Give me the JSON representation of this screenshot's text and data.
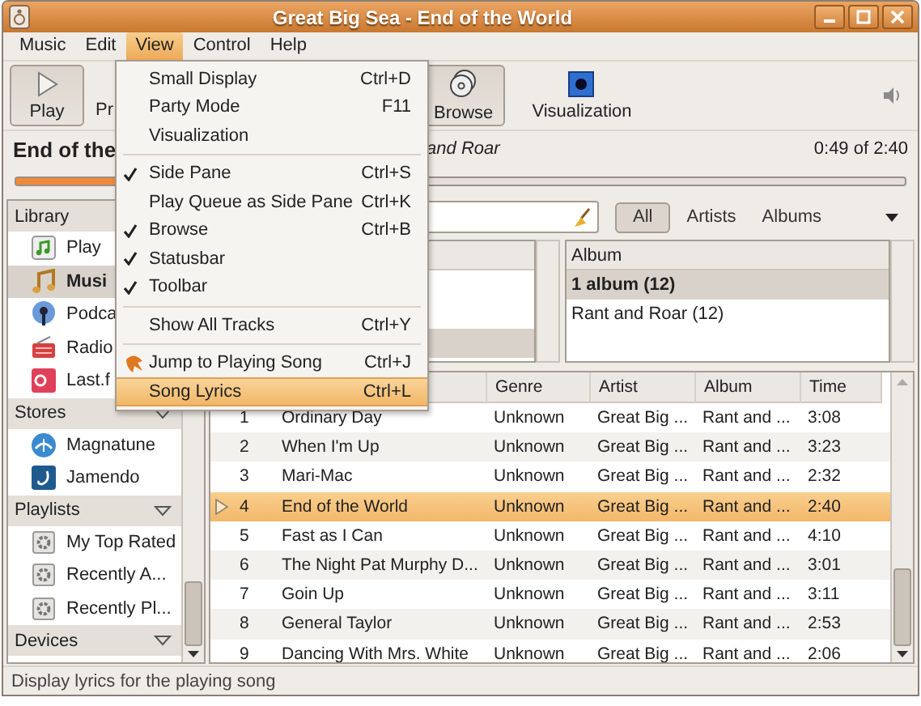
{
  "window": {
    "title": "Great Big Sea - End of the World"
  },
  "menubar": [
    {
      "label": "Music",
      "selected": false
    },
    {
      "label": "Edit",
      "selected": false
    },
    {
      "label": "View",
      "selected": true
    },
    {
      "label": "Control",
      "selected": false
    },
    {
      "label": "Help",
      "selected": false
    }
  ],
  "toolbar": [
    {
      "kind": "play",
      "label": "Play",
      "pressed": true
    },
    {
      "kind": "previous",
      "label": "Pr",
      "pressed": false
    },
    {
      "kind": "browse",
      "label": "Browse",
      "pressed": true
    },
    {
      "kind": "visualization",
      "label": "Visualization",
      "pressed": false
    }
  ],
  "now_playing": {
    "title": "End of the",
    "subtitle": "and Roar",
    "time": "0:49 of 2:40",
    "level": 0.31
  },
  "sidebar": [
    {
      "title": "Library",
      "items": [
        {
          "kind": "queue",
          "label": "Play",
          "selected": false
        },
        {
          "kind": "music",
          "label": "Musi",
          "selected": true
        },
        {
          "kind": "podcast",
          "label": "Podca",
          "selected": false
        },
        {
          "kind": "radio",
          "label": "Radio",
          "selected": false
        },
        {
          "kind": "lastfm",
          "label": "Last.f",
          "selected": false
        }
      ]
    },
    {
      "title": "Stores",
      "items": [
        {
          "kind": "magnatune",
          "label": "Magnatune",
          "selected": false
        },
        {
          "kind": "jamendo",
          "label": "Jamendo",
          "selected": false
        }
      ]
    },
    {
      "title": "Playlists",
      "items": [
        {
          "kind": "auto",
          "label": "My Top Rated",
          "selected": false
        },
        {
          "kind": "auto",
          "label": "Recently A...",
          "selected": false
        },
        {
          "kind": "auto",
          "label": "Recently Pl...",
          "selected": false
        }
      ]
    },
    {
      "title": "Devices"
    }
  ],
  "filter_tabs": [
    {
      "label": "All",
      "selected": true
    },
    {
      "label": "Artists",
      "selected": false
    },
    {
      "label": "Albums",
      "selected": false
    }
  ],
  "album_browser": {
    "header": "Album",
    "rows": [
      {
        "label": "1 album (12)",
        "selected": true
      },
      {
        "label": "Rant and Roar (12)",
        "selected": false
      }
    ]
  },
  "tracks": {
    "columns": [
      "Genre",
      "Artist",
      "Album",
      "Time"
    ],
    "rows": [
      {
        "number": "1",
        "title": "Ordinary Day",
        "genre": "Unknown",
        "artist": "Great Big ...",
        "album": "Rant and ...",
        "time": "3:08",
        "playing": false,
        "selected": false
      },
      {
        "number": "2",
        "title": "When I'm Up",
        "genre": "Unknown",
        "artist": "Great Big ...",
        "album": "Rant and ...",
        "time": "3:23",
        "playing": false,
        "selected": false
      },
      {
        "number": "3",
        "title": "Mari-Mac",
        "genre": "Unknown",
        "artist": "Great Big ...",
        "album": "Rant and ...",
        "time": "2:32",
        "playing": false,
        "selected": false
      },
      {
        "number": "4",
        "title": "End of the World",
        "genre": "Unknown",
        "artist": "Great Big ...",
        "album": "Rant and ...",
        "time": "2:40",
        "playing": true,
        "selected": true
      },
      {
        "number": "5",
        "title": "Fast as I Can",
        "genre": "Unknown",
        "artist": "Great Big ...",
        "album": "Rant and ...",
        "time": "4:10",
        "playing": false,
        "selected": false
      },
      {
        "number": "6",
        "title": "The Night Pat Murphy D...",
        "genre": "Unknown",
        "artist": "Great Big ...",
        "album": "Rant and ...",
        "time": "3:01",
        "playing": false,
        "selected": false
      },
      {
        "number": "7",
        "title": "Goin Up",
        "genre": "Unknown",
        "artist": "Great Big ...",
        "album": "Rant and ...",
        "time": "3:11",
        "playing": false,
        "selected": false
      },
      {
        "number": "8",
        "title": "General Taylor",
        "genre": "Unknown",
        "artist": "Great Big ...",
        "album": "Rant and ...",
        "time": "2:53",
        "playing": false,
        "selected": false
      },
      {
        "number": "9",
        "title": "Dancing With Mrs. White",
        "genre": "Unknown",
        "artist": "Great Big ...",
        "album": "Rant and ...",
        "time": "2:06",
        "playing": false,
        "selected": false
      }
    ]
  },
  "view_menu": [
    {
      "kind": "item",
      "label": "Small Display",
      "shortcut": "Ctrl+D",
      "selected": false
    },
    {
      "kind": "item",
      "label": "Party Mode",
      "shortcut": "F11",
      "selected": false
    },
    {
      "kind": "item",
      "label": "Visualization",
      "selected": false
    },
    {
      "kind": "separator"
    },
    {
      "kind": "check",
      "label": "Side Pane",
      "shortcut": "Ctrl+S",
      "checked": true,
      "selected": false
    },
    {
      "kind": "check",
      "label": "Play Queue as Side Pane",
      "shortcut": "Ctrl+K",
      "checked": false,
      "selected": false
    },
    {
      "kind": "check",
      "label": "Browse",
      "shortcut": "Ctrl+B",
      "checked": true,
      "selected": false
    },
    {
      "kind": "check",
      "label": "Statusbar",
      "checked": true,
      "selected": false
    },
    {
      "kind": "check",
      "label": "Toolbar",
      "checked": true,
      "selected": false
    },
    {
      "kind": "separator"
    },
    {
      "kind": "item",
      "label": "Show All Tracks",
      "shortcut": "Ctrl+Y",
      "selected": false
    },
    {
      "kind": "separator"
    },
    {
      "kind": "jump",
      "label": "Jump to Playing Song",
      "shortcut": "Ctrl+J",
      "selected": false
    },
    {
      "kind": "item",
      "label": "Song Lyrics",
      "shortcut": "Ctrl+L",
      "selected": true
    }
  ],
  "status_bar": "Display lyrics for the playing song"
}
